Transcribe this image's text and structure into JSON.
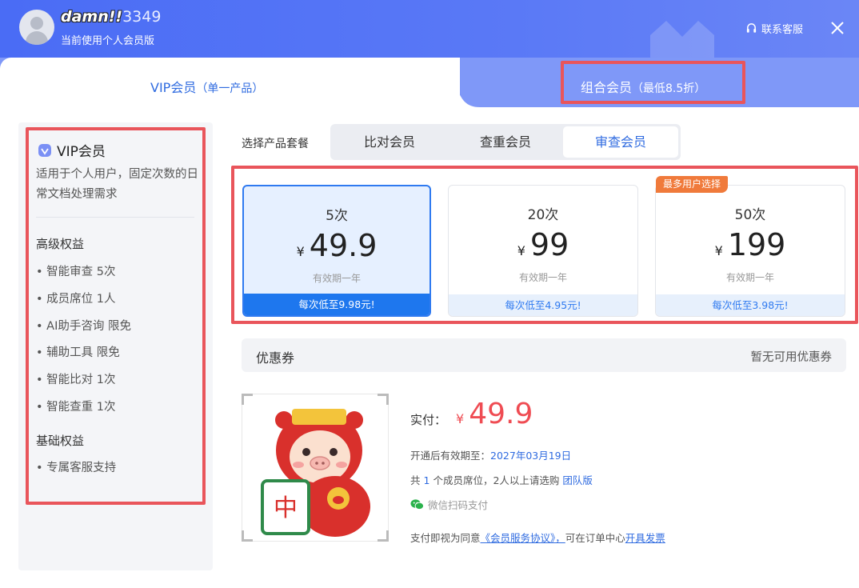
{
  "header": {
    "username_nick": "damn!!",
    "username_digits": "3349",
    "subtitle": "当前使用个人会员版",
    "service_label": "联系客服"
  },
  "tabs": {
    "left": {
      "label": "VIP会员",
      "suffix": "（单一产品）"
    },
    "right": {
      "label": "组合会员",
      "suffix": "（最低8.5折）"
    }
  },
  "sidebar": {
    "title": "VIP会员",
    "description": "适用于个人用户，固定次数的日常文档处理需求",
    "advanced_title": "高级权益",
    "advanced": [
      "• 智能审查 5次",
      "• 成员席位 1人",
      "• AI助手咨询 限免",
      "• 辅助工具 限免",
      "• 智能比对 1次",
      "• 智能查重 1次"
    ],
    "basic_title": "基础权益",
    "basic": [
      "• 专属客服支持"
    ]
  },
  "package": {
    "label": "选择产品套餐",
    "options": [
      "比对会员",
      "查重会员",
      "审查会员"
    ],
    "selected": "审查会员"
  },
  "cards": [
    {
      "times": "5次",
      "price": "49.9",
      "validity": "有效期一年",
      "footer": "每次低至9.98元!"
    },
    {
      "times": "20次",
      "price": "99",
      "validity": "有效期一年",
      "footer": "每次低至4.95元!"
    },
    {
      "times": "50次",
      "price": "199",
      "validity": "有效期一年",
      "footer": "每次低至3.98元!"
    }
  ],
  "currency": "¥",
  "badge": "最多用户选择",
  "coupon": {
    "label": "优惠券",
    "value": "暂无可用优惠券"
  },
  "payment": {
    "label": "实付：",
    "amount": "49.9",
    "expiry_label": "开通后有效期至：",
    "expiry_date": "2027年03月19日",
    "seats_pre": "共",
    "seats_count": "1",
    "seats_post": "个成员席位，2人以上请选购",
    "team_link": "团队版",
    "method": "微信扫码支付",
    "agree_pre": "支付即视为同意",
    "agreement_link": "《会员服务协议》，",
    "agree_mid": "可在订单中心",
    "invoice_link": "开具发票"
  },
  "colors": {
    "brand": "#4a6cf5",
    "accent": "#2f7af0",
    "price": "#ef4c53",
    "badge": "#f07a3b",
    "highlight": "#e9555b"
  }
}
